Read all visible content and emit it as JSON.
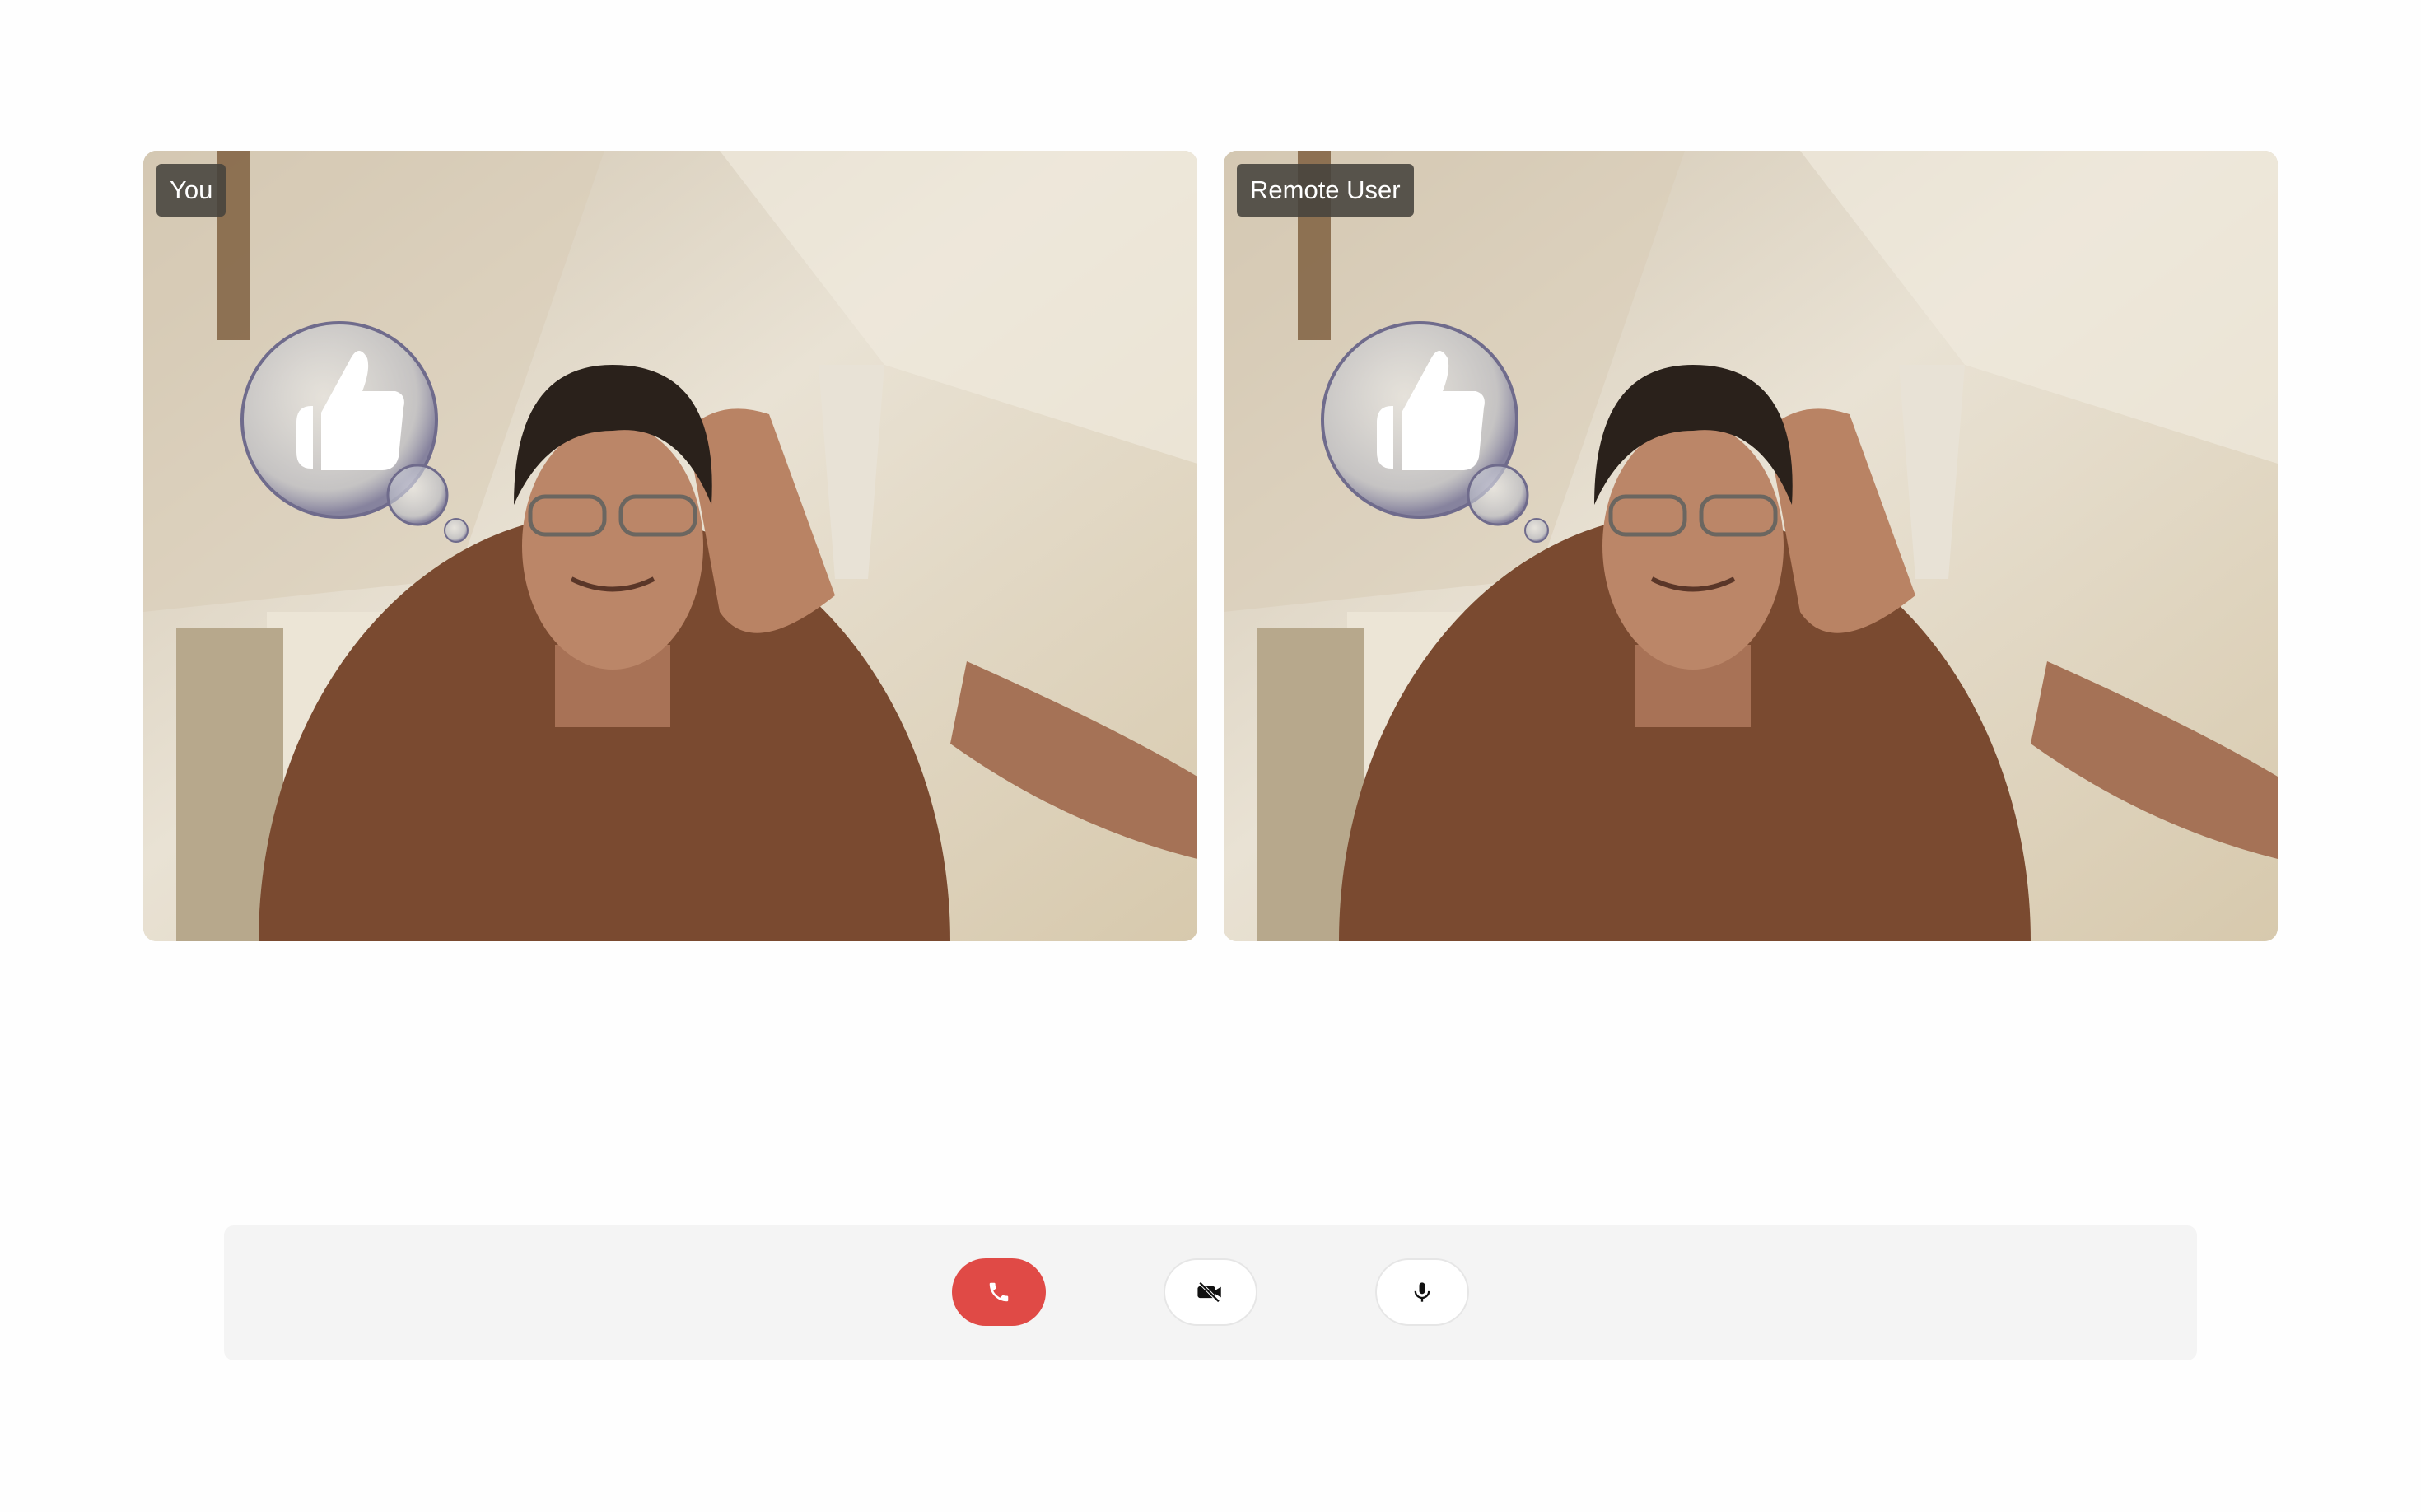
{
  "video_tiles": [
    {
      "label": "You",
      "role": "local",
      "reaction": "thumbs-up-bubble-icon"
    },
    {
      "label": "Remote User",
      "role": "remote",
      "reaction": "thumbs-up-bubble-icon"
    }
  ],
  "controls": {
    "end_call": {
      "icon": "phone-hangup-icon",
      "color": "#e04a46"
    },
    "toggle_video": {
      "icon": "video-off-icon",
      "state": "off"
    },
    "toggle_mic": {
      "icon": "microphone-icon",
      "state": "on"
    }
  },
  "colors": {
    "background": "#fefefe",
    "control_bar": "#f4f4f4",
    "label_bg": "#46423c"
  }
}
